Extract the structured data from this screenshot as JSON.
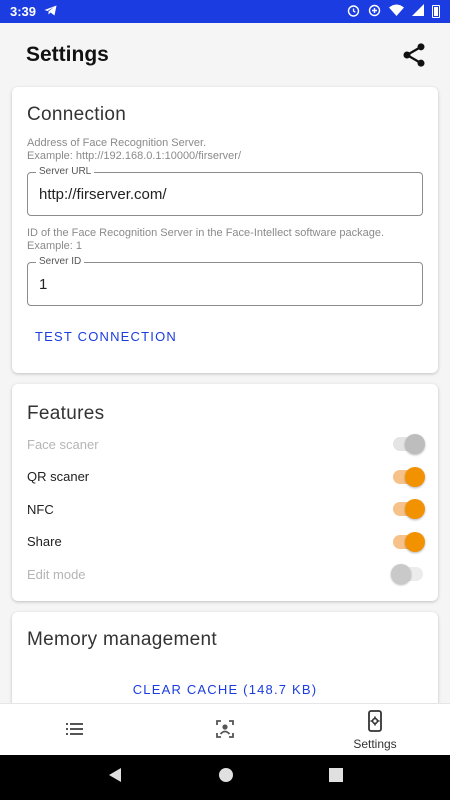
{
  "status_bar": {
    "time": "3:39",
    "icons": [
      "telegram-icon",
      "alarm-icon",
      "data-saver-icon",
      "wifi-icon",
      "signal-icon",
      "battery-icon"
    ]
  },
  "header": {
    "title": "Settings",
    "share_icon": "share-icon"
  },
  "connection": {
    "title": "Connection",
    "server_url_help": [
      "Address of Face Recognition Server.",
      "Example: http://192.168.0.1:10000/firserver/"
    ],
    "server_url_label": "Server URL",
    "server_url_value": "http://firserver.com/",
    "server_id_help": [
      "ID of the Face Recognition Server in the Face-Intellect software package.",
      "Example: 1"
    ],
    "server_id_label": "Server ID",
    "server_id_value": "1",
    "test_button": "TEST CONNECTION"
  },
  "features": {
    "title": "Features",
    "items": [
      {
        "label": "Face scaner",
        "enabled": false,
        "on": true
      },
      {
        "label": "QR scaner",
        "enabled": true,
        "on": true
      },
      {
        "label": "NFC",
        "enabled": true,
        "on": true
      },
      {
        "label": "Share",
        "enabled": true,
        "on": true
      },
      {
        "label": "Edit mode",
        "enabled": false,
        "on": false
      }
    ]
  },
  "memory": {
    "title": "Memory management",
    "clear_cache_button": "CLEAR CACHE (148.7 KB)"
  },
  "bottom_nav": {
    "items": [
      {
        "icon": "list-icon",
        "label": ""
      },
      {
        "icon": "face-scan-icon",
        "label": ""
      },
      {
        "icon": "settings-phone-icon",
        "label": "Settings"
      }
    ]
  },
  "colors": {
    "status_bar": "#1a3ce0",
    "accent": "#f39200",
    "link": "#1a3ce0"
  }
}
